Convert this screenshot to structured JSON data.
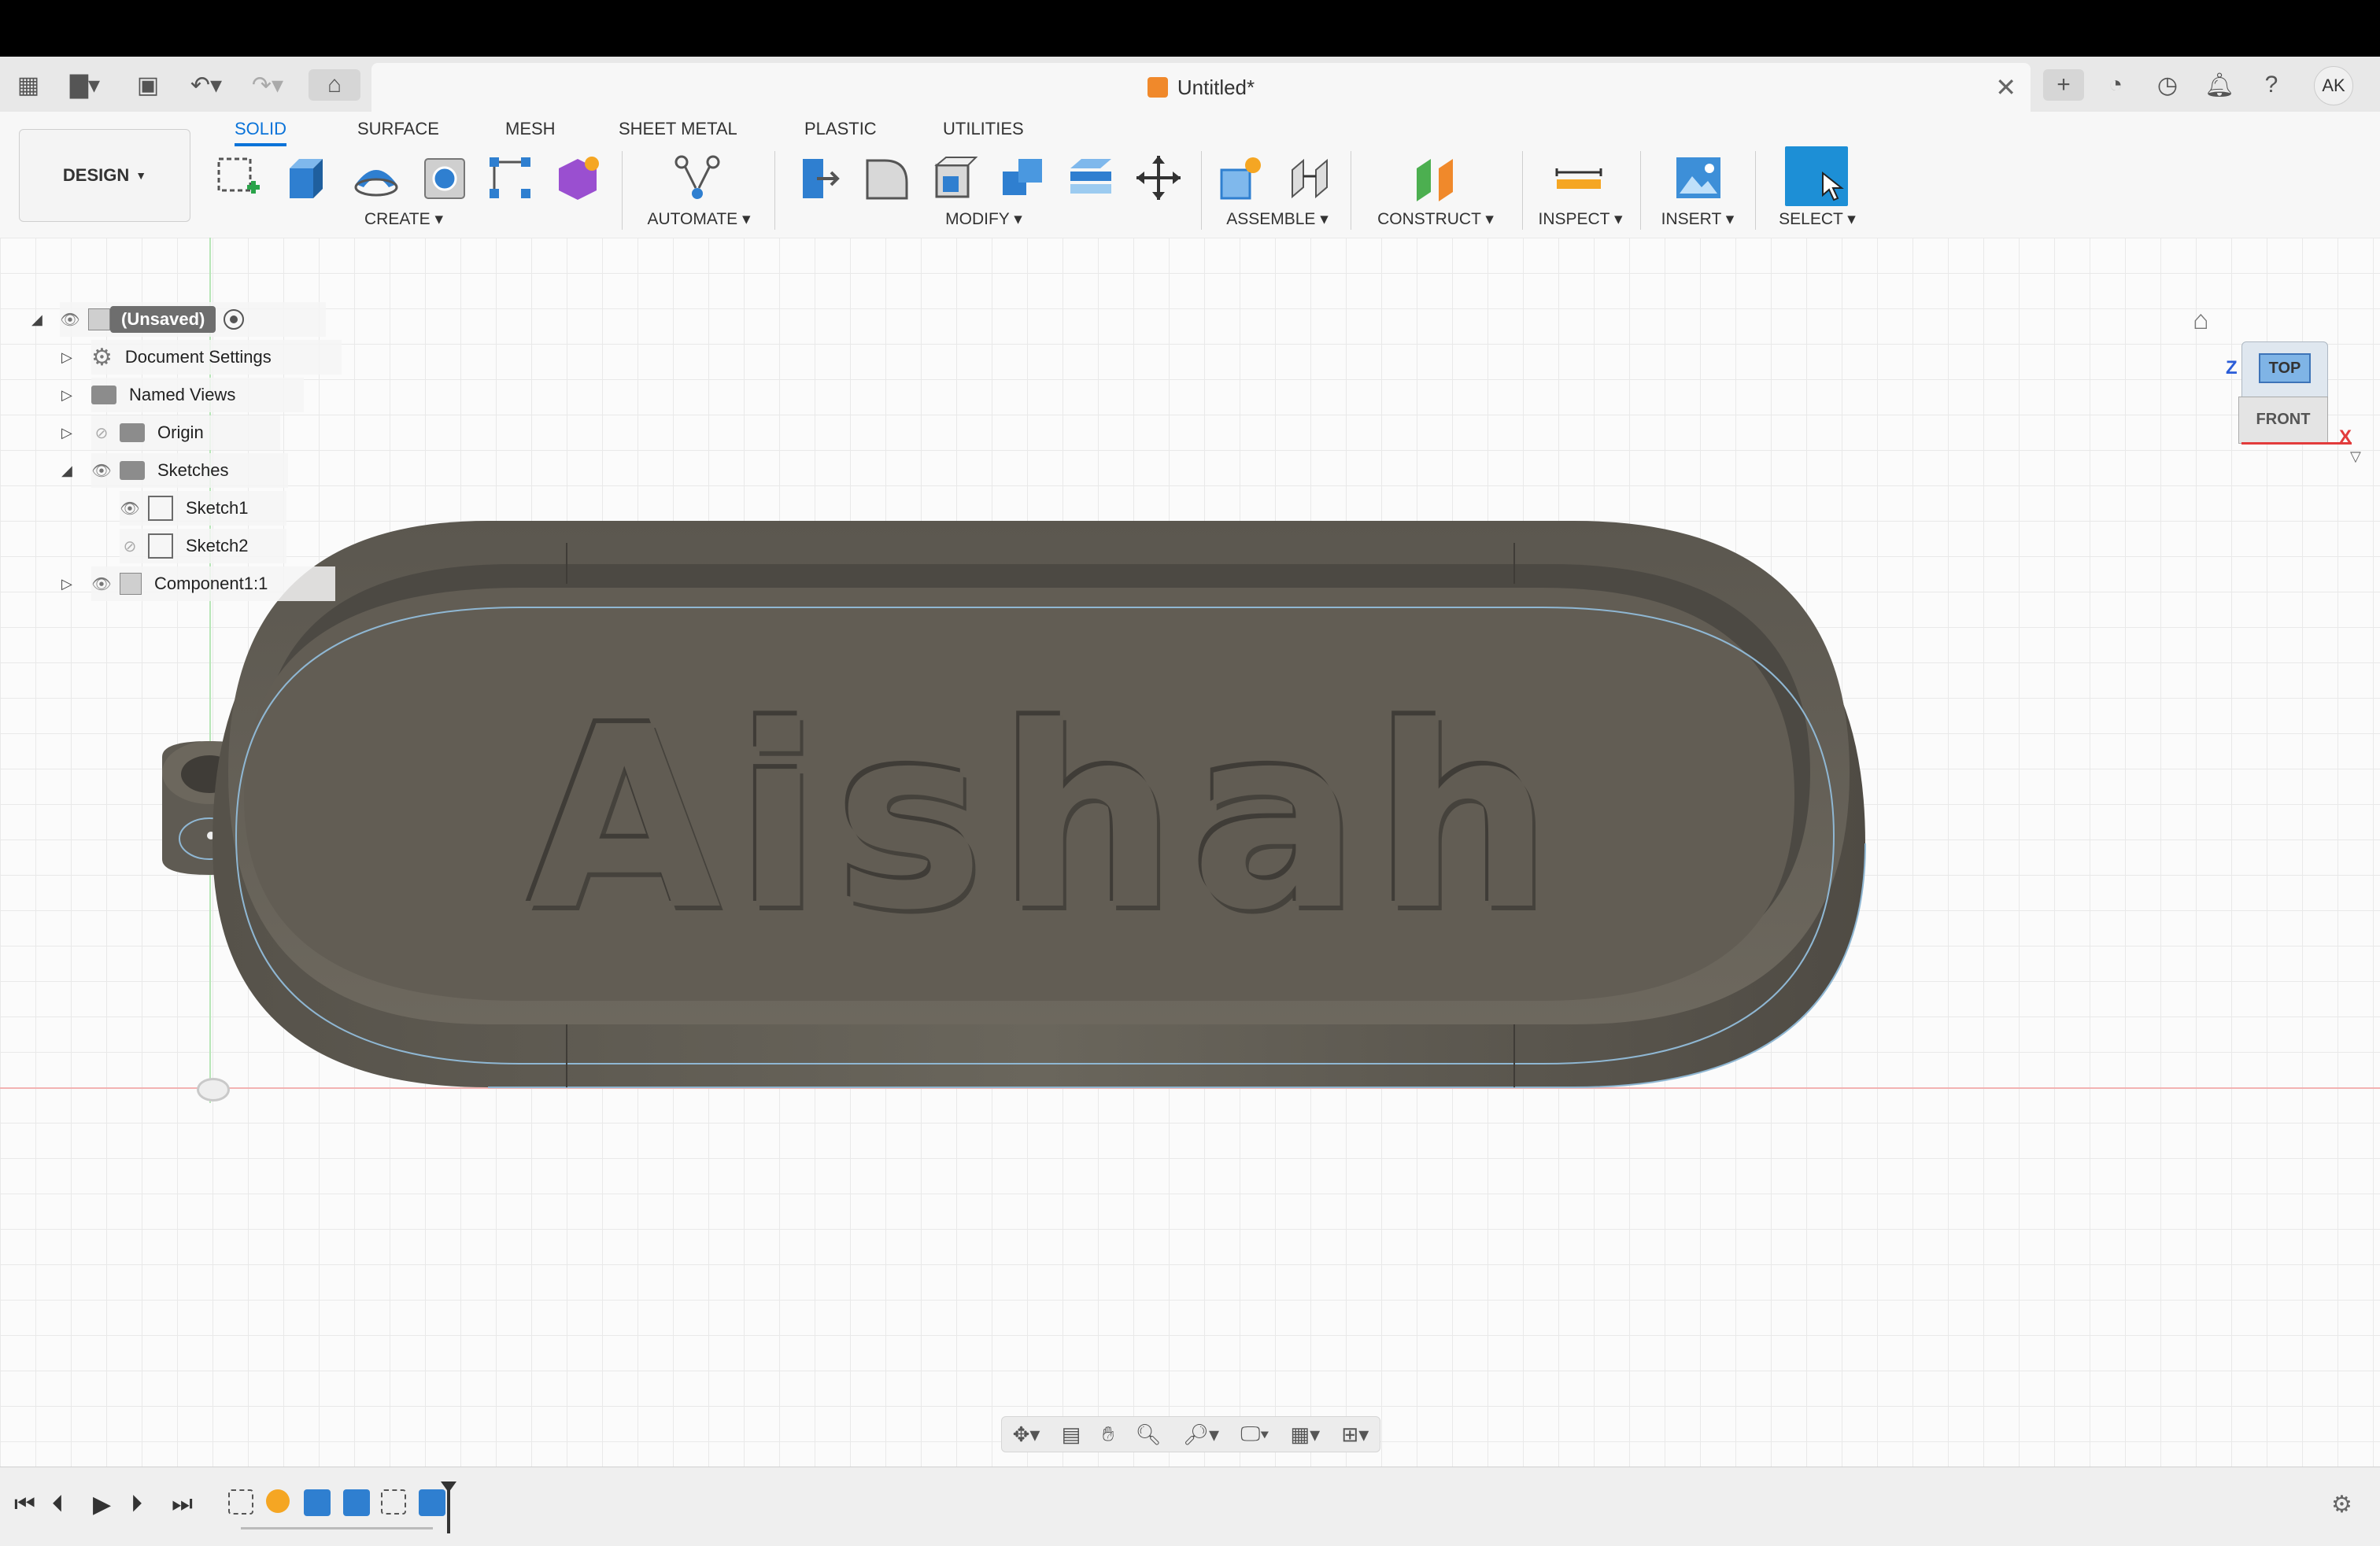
{
  "app": {
    "document_title": "Untitled*",
    "user_initials": "AK"
  },
  "ribbon": {
    "workspace_label": "DESIGN",
    "tabs": [
      "SOLID",
      "SURFACE",
      "MESH",
      "SHEET METAL",
      "PLASTIC",
      "UTILITIES"
    ],
    "active_tab": "SOLID",
    "groups": [
      "CREATE",
      "AUTOMATE",
      "MODIFY",
      "ASSEMBLE",
      "CONSTRUCT",
      "INSPECT",
      "INSERT",
      "SELECT"
    ]
  },
  "browser": {
    "root": "(Unsaved)",
    "items": [
      "Document Settings",
      "Named Views",
      "Origin",
      "Sketches",
      "Sketch1",
      "Sketch2",
      "Component1:1"
    ]
  },
  "model": {
    "engraved_text": "Aishah"
  },
  "viewcube": {
    "top": "TOP",
    "front": "FRONT",
    "axis_z": "Z",
    "axis_x": "X"
  },
  "colors": {
    "accent": "#0a73d9",
    "model_body": "#6b665c",
    "select_tool": "#1d8fd6"
  }
}
